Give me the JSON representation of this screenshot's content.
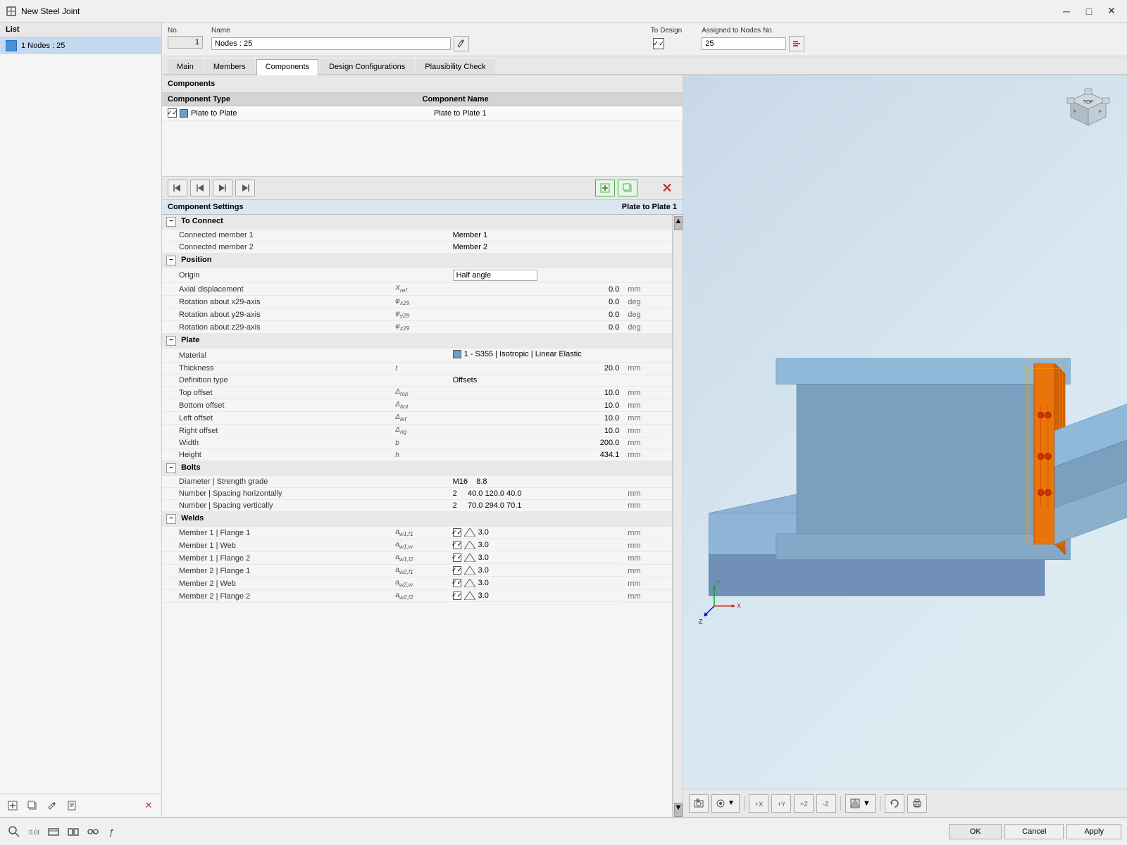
{
  "titlebar": {
    "title": "New Steel Joint",
    "minimize": "─",
    "maximize": "□",
    "close": "✕"
  },
  "left_panel": {
    "header": "List",
    "item": "1  Nodes : 25",
    "bottom_buttons": [
      "⊞",
      "📋",
      "✏",
      "📄",
      "✕"
    ]
  },
  "top_form": {
    "no_label": "No.",
    "no_value": "1",
    "name_label": "Name",
    "name_value": "Nodes : 25",
    "to_design_label": "To Design",
    "to_design_checked": true,
    "assigned_label": "Assigned to Nodes No.",
    "assigned_value": "25"
  },
  "tabs": [
    "Main",
    "Members",
    "Components",
    "Design Configurations",
    "Plausibility Check"
  ],
  "active_tab": "Components",
  "components_section": {
    "header": "Components",
    "col_type": "Component Type",
    "col_name": "Component Name",
    "items": [
      {
        "checked": true,
        "type": "Plate to Plate",
        "name": "Plate to Plate 1"
      }
    ]
  },
  "component_settings": {
    "header_left": "Component Settings",
    "header_right": "Plate to Plate 1",
    "sections": {
      "to_connect": {
        "label": "To Connect",
        "items": [
          {
            "label": "Connected member 1",
            "symbol": "",
            "value": "Member 1",
            "unit": ""
          },
          {
            "label": "Connected member 2",
            "symbol": "",
            "value": "Member 2",
            "unit": ""
          }
        ]
      },
      "position": {
        "label": "Position",
        "items": [
          {
            "label": "Origin",
            "symbol": "",
            "value": "Half angle",
            "unit": "",
            "is_dropdown": true
          },
          {
            "label": "Axial displacement",
            "symbol": "Xref",
            "value": "0.0",
            "unit": "mm"
          },
          {
            "label": "Rotation about x29-axis",
            "symbol": "φx29",
            "value": "0.0",
            "unit": "deg"
          },
          {
            "label": "Rotation about y29-axis",
            "symbol": "φy29",
            "value": "0.0",
            "unit": "deg"
          },
          {
            "label": "Rotation about z29-axis",
            "symbol": "φz29",
            "value": "0.0",
            "unit": "deg"
          }
        ]
      },
      "plate": {
        "label": "Plate",
        "items": [
          {
            "label": "Material",
            "symbol": "",
            "value": "1 - S355 | Isotropic | Linear Elastic",
            "unit": "",
            "has_color": true
          },
          {
            "label": "Thickness",
            "symbol": "t",
            "value": "20.0",
            "unit": "mm"
          },
          {
            "label": "Definition type",
            "symbol": "",
            "value": "Offsets",
            "unit": ""
          },
          {
            "label": "Top offset",
            "symbol": "Δtop",
            "value": "10.0",
            "unit": "mm"
          },
          {
            "label": "Bottom offset",
            "symbol": "Δbot",
            "value": "10.0",
            "unit": "mm"
          },
          {
            "label": "Left offset",
            "symbol": "Δlef",
            "value": "10.0",
            "unit": "mm"
          },
          {
            "label": "Right offset",
            "symbol": "Δrig",
            "value": "10.0",
            "unit": "mm"
          },
          {
            "label": "Width",
            "symbol": "b",
            "value": "200.0",
            "unit": "mm"
          },
          {
            "label": "Height",
            "symbol": "h",
            "value": "434.1",
            "unit": "mm"
          }
        ]
      },
      "bolts": {
        "label": "Bolts",
        "items": [
          {
            "label": "Diameter | Strength grade",
            "symbol": "",
            "value": "M16    8.8",
            "unit": ""
          },
          {
            "label": "Number | Spacing horizontally",
            "symbol": "",
            "value": "2    40.0  120.0  40.0",
            "unit": "mm"
          },
          {
            "label": "Number | Spacing vertically",
            "symbol": "",
            "value": "2    70.0  294.0  70.1",
            "unit": "mm"
          }
        ]
      },
      "welds": {
        "label": "Welds",
        "items": [
          {
            "label": "Member 1 | Flange 1",
            "symbol": "aw1,f1",
            "value": "3.0",
            "unit": "mm"
          },
          {
            "label": "Member 1 | Web",
            "symbol": "aw1,w",
            "value": "3.0",
            "unit": "mm"
          },
          {
            "label": "Member 1 | Flange 2",
            "symbol": "aw1,f2",
            "value": "3.0",
            "unit": "mm"
          },
          {
            "label": "Member 2 | Flange 1",
            "symbol": "aw2,f1",
            "value": "3.0",
            "unit": "mm"
          },
          {
            "label": "Member 2 | Web",
            "symbol": "aw2,w",
            "value": "3.0",
            "unit": "mm"
          },
          {
            "label": "Member 2 | Flange 2",
            "symbol": "aw2,f2",
            "value": "3.0",
            "unit": "mm"
          }
        ]
      }
    }
  },
  "toolbar_buttons": {
    "nav": [
      "◀◀",
      "◀",
      "▶",
      "▶▶"
    ],
    "add": [
      "➕",
      "📋"
    ],
    "delete_label": "✕"
  },
  "viewport_toolbar": {
    "buttons": [
      "📋",
      "🔍",
      "↔",
      "↕",
      "↙",
      "↗",
      "🔲",
      "▼",
      "🔲",
      "↺",
      "📐"
    ]
  },
  "bottom_buttons": {
    "ok": "OK",
    "cancel": "Cancel",
    "apply": "Apply"
  }
}
